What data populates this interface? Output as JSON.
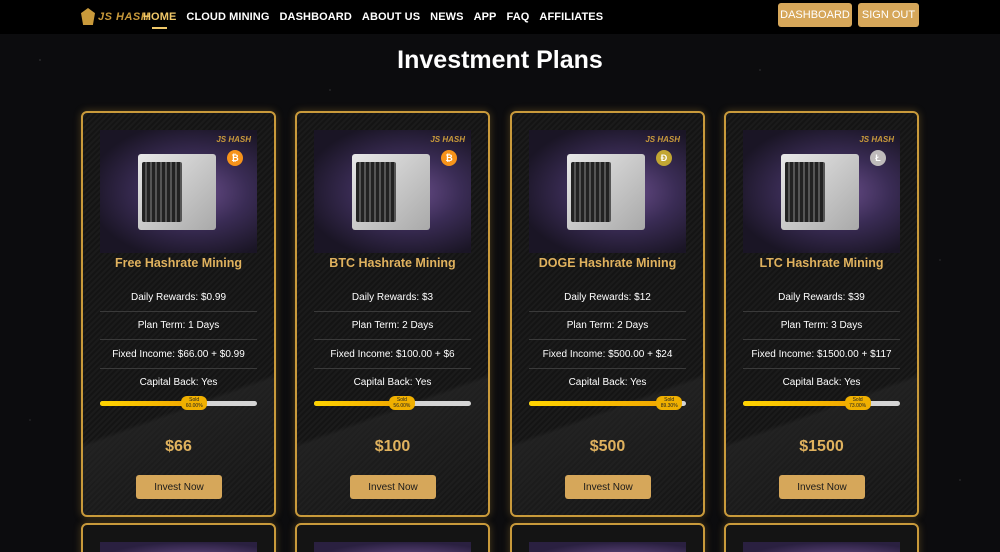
{
  "brand": {
    "logo_text": "JS HASH",
    "accent": "#c99a3b"
  },
  "nav": {
    "items": [
      "HOME",
      "CLOUD MINING",
      "DASHBOARD",
      "ABOUT US",
      "NEWS",
      "APP",
      "FAQ",
      "AFFILIATES"
    ],
    "active": "HOME",
    "dashboard_button": "DASHBOARD",
    "signout_button": "SIGN OUT"
  },
  "page": {
    "title": "Investment Plans"
  },
  "plans": [
    {
      "title": "Free Hashrate Mining",
      "coin": "btc-icon",
      "coin_color": "#f7931a",
      "coin_glyph": "₿",
      "daily": "Daily Rewards: $0.99",
      "term": "Plan Term: 1 Days",
      "income": "Fixed Income: $66.00 + $0.99",
      "capital": "Capital Back:  Yes",
      "sold_label": "Sold",
      "sold_pct": "60.00%",
      "progress": 0.6,
      "price": "$66",
      "button": "Invest Now"
    },
    {
      "title": "BTC Hashrate Mining",
      "coin": "btc-icon",
      "coin_color": "#f7931a",
      "coin_glyph": "₿",
      "daily": "Daily Rewards: $3",
      "term": "Plan Term: 2 Days",
      "income": "Fixed Income: $100.00 + $6",
      "capital": "Capital Back:  Yes",
      "sold_label": "Sold",
      "sold_pct": "56.00%",
      "progress": 0.56,
      "price": "$100",
      "button": "Invest Now"
    },
    {
      "title": "DOGE Hashrate Mining",
      "coin": "doge-icon",
      "coin_color": "#c2a633",
      "coin_glyph": "Ð",
      "daily": "Daily Rewards: $12",
      "term": "Plan Term: 2 Days",
      "income": "Fixed Income: $500.00 + $24",
      "capital": "Capital Back:  Yes",
      "sold_label": "Sold",
      "sold_pct": "89.30%",
      "progress": 0.893,
      "price": "$500",
      "button": "Invest Now"
    },
    {
      "title": "LTC Hashrate Mining",
      "coin": "ltc-icon",
      "coin_color": "#bfbbbb",
      "coin_glyph": "Ł",
      "daily": "Daily Rewards: $39",
      "term": "Plan Term: 3 Days",
      "income": "Fixed Income: $1500.00 + $117",
      "capital": "Capital Back:  Yes",
      "sold_label": "Sold",
      "sold_pct": "73.00%",
      "progress": 0.73,
      "price": "$1500",
      "button": "Invest Now"
    }
  ]
}
